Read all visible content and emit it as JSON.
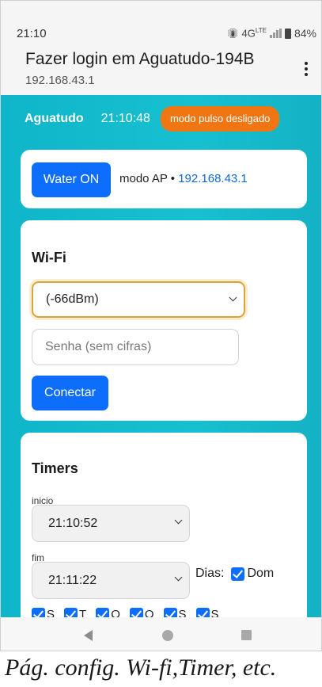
{
  "status_bar": {
    "time": "21:10",
    "network": "4G",
    "network_sup": "LTE",
    "battery": "84%"
  },
  "title_bar": {
    "title": "Fazer login em Aguatudo-194B",
    "subtitle": "192.168.43.1"
  },
  "header": {
    "brand": "Aguatudo",
    "time": "21:10:48",
    "badge": "modo pulso desligado",
    "badge_color": "#f07614"
  },
  "ap_card": {
    "water_button": "Water ON",
    "mode_text": "modo AP • ",
    "ip": "192.168.43.1"
  },
  "wifi": {
    "title": "Wi-Fi",
    "selected_network": "(-66dBm)",
    "password_placeholder": "Senha (sem cifras)",
    "connect_button": "Conectar"
  },
  "timers": {
    "title": "Timers",
    "start_label": "inicio",
    "start_value": "21:10:52",
    "end_label": "fim",
    "end_value": "21:11:22",
    "days_label": "Dias:",
    "first_day": "Dom",
    "days_row": [
      "S",
      "T",
      "Q",
      "Q",
      "S",
      "S"
    ]
  },
  "caption": "Pág. config. Wi-fi,Timer, etc.",
  "colors": {
    "accent": "#0d6efd",
    "background": "#13b8cb",
    "focus_border": "#d9a53a"
  }
}
